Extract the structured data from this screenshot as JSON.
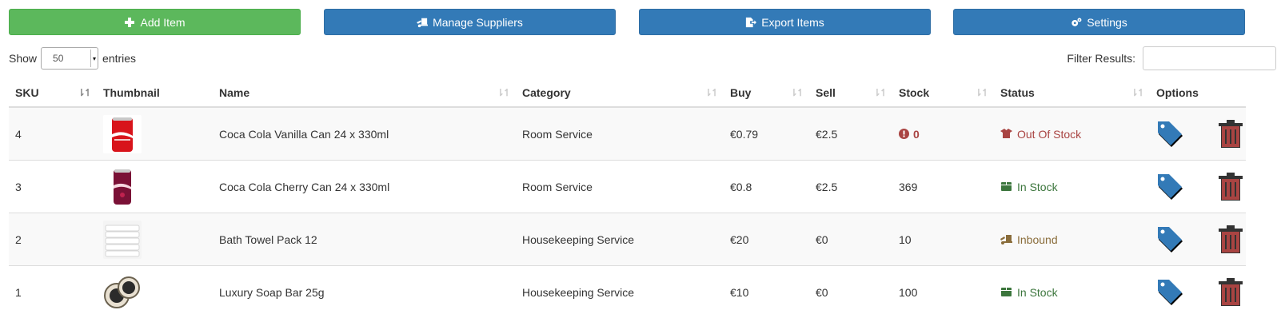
{
  "toolbar": {
    "add_label": "Add Item",
    "suppliers_label": "Manage Suppliers",
    "export_label": "Export Items",
    "settings_label": "Settings"
  },
  "controls": {
    "show_label": "Show",
    "entries_value": "50",
    "entries_label": "entries",
    "filter_label": "Filter Results:",
    "filter_value": ""
  },
  "table": {
    "headers": {
      "sku": "SKU",
      "thumbnail": "Thumbnail",
      "name": "Name",
      "category": "Category",
      "buy": "Buy",
      "sell": "Sell",
      "stock": "Stock",
      "status": "Status",
      "options": "Options"
    },
    "rows": [
      {
        "sku": "4",
        "thumbnail_icon": "coca-cola-vanilla-can",
        "name": "Coca Cola Vanilla Can 24 x 330ml",
        "category": "Room Service",
        "buy": "€0.79",
        "sell": "€2.5",
        "stock": "0",
        "status": "Out Of Stock"
      },
      {
        "sku": "3",
        "thumbnail_icon": "coca-cola-cherry-can",
        "name": "Coca Cola Cherry Can 24 x 330ml",
        "category": "Room Service",
        "buy": "€0.8",
        "sell": "€2.5",
        "stock": "369",
        "status": "In Stock"
      },
      {
        "sku": "2",
        "thumbnail_icon": "towel-stack",
        "name": "Bath Towel Pack 12",
        "category": "Housekeeping Service",
        "buy": "€20",
        "sell": "€0",
        "stock": "10",
        "status": "Inbound"
      },
      {
        "sku": "1",
        "thumbnail_icon": "soap-bars",
        "name": "Luxury Soap Bar 25g",
        "category": "Housekeeping Service",
        "buy": "€10",
        "sell": "€0",
        "stock": "100",
        "status": "In Stock"
      }
    ]
  },
  "colors": {
    "success": "#5cb85c",
    "primary": "#337ab7",
    "danger": "#a94442",
    "in_stock": "#3c763d",
    "inbound": "#8a6d3b"
  }
}
